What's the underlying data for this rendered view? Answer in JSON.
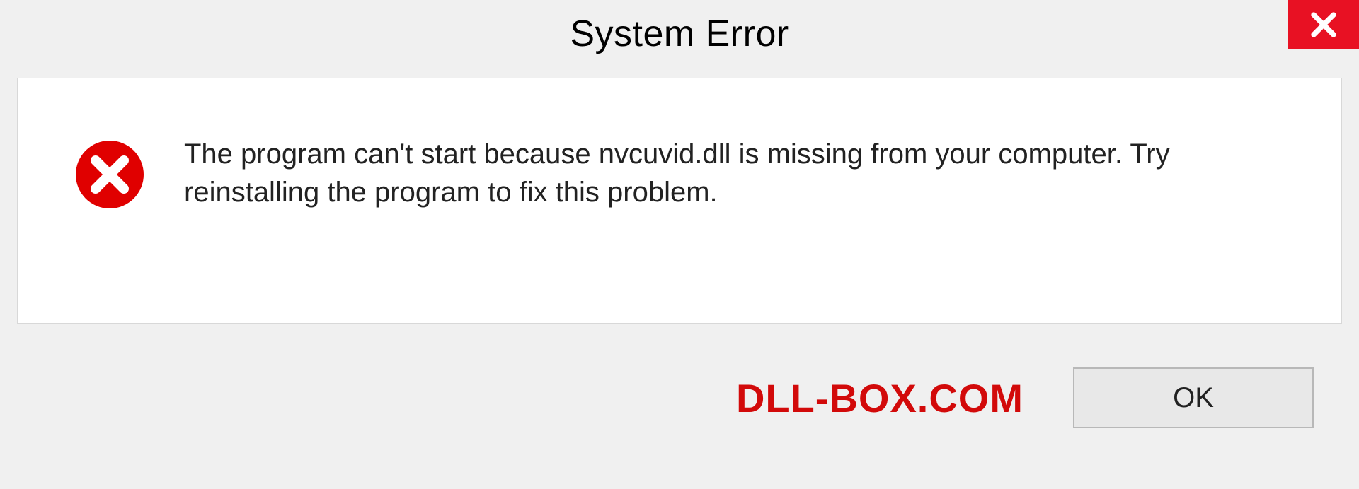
{
  "dialog": {
    "title": "System Error",
    "message": "The program can't start because nvcuvid.dll is missing from your computer. Try reinstalling the program to fix this problem.",
    "ok_label": "OK"
  },
  "watermark": {
    "text": "DLL-BOX.COM"
  },
  "colors": {
    "close_bg": "#e81123",
    "error_icon": "#e00000",
    "watermark": "#d20a0a"
  }
}
